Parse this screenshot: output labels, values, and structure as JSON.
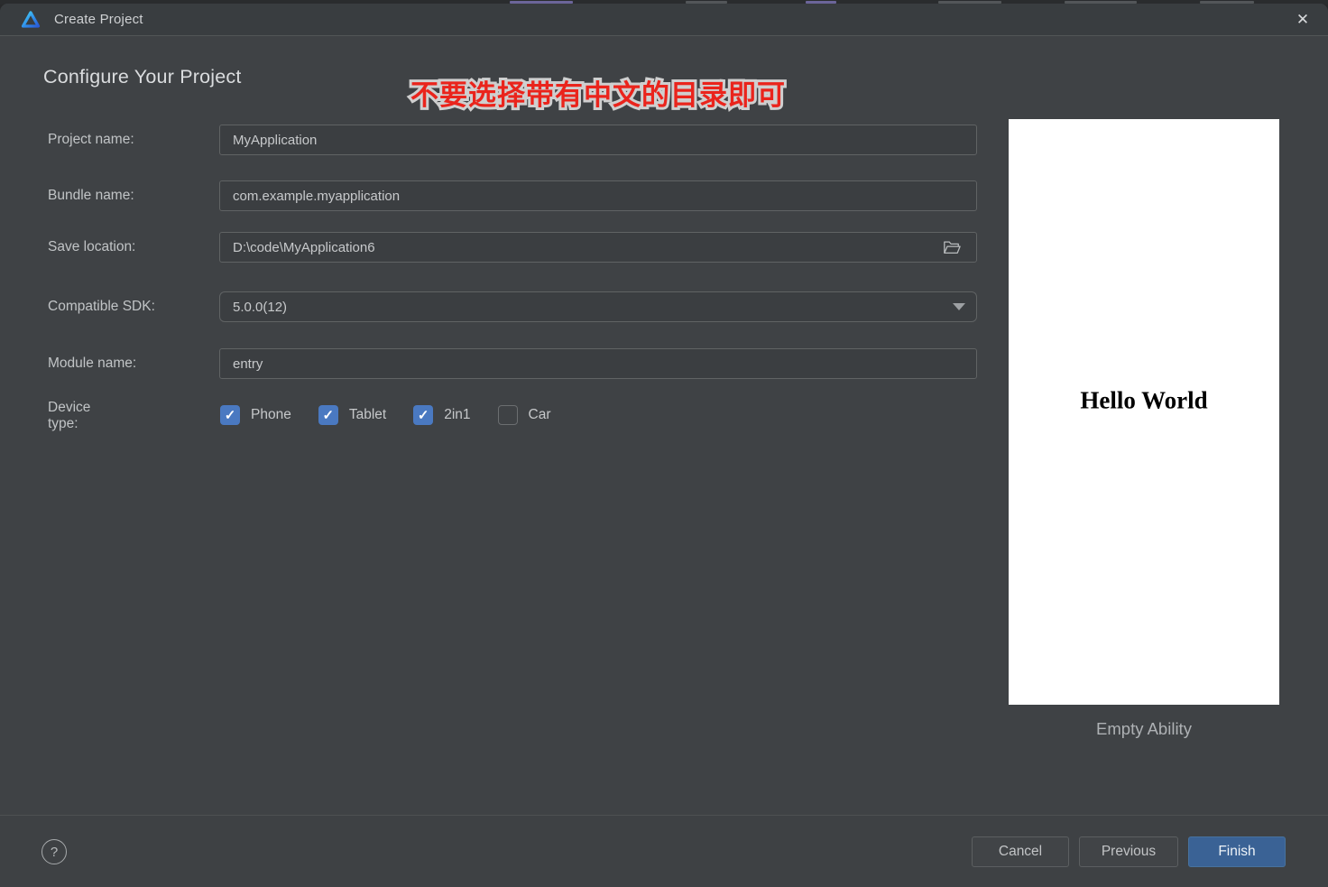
{
  "window": {
    "title": "Create Project",
    "close_icon": "✕",
    "logo_icon": "deveco-studio-logo"
  },
  "page": {
    "heading": "Configure Your Project",
    "annotation": "不要选择带有中文的目录即可",
    "annotation_color": "#ea241c"
  },
  "form": {
    "fields": [
      {
        "label": "Project name:",
        "value": "MyApplication"
      },
      {
        "label": "Bundle name:",
        "value": "com.example.myapplication"
      },
      {
        "label": "Save location:",
        "value": "D:\\code\\MyApplication6",
        "trailing_icon": "folder-open-icon"
      },
      {
        "label": "Compatible SDK:",
        "value": "5.0.0(12)",
        "trailing_icon": "dropdown-arrow-icon"
      },
      {
        "label": "Module name:",
        "value": "entry"
      }
    ],
    "device_type": {
      "label": "Device type:",
      "options": [
        {
          "label": "Phone",
          "state": "checked"
        },
        {
          "label": "Tablet",
          "state": "checked"
        },
        {
          "label": "2in1",
          "state": "checked"
        },
        {
          "label": "Car",
          "state": "unchecked"
        }
      ]
    }
  },
  "preview": {
    "screen_text": "Hello World",
    "caption": "Empty Ability",
    "screen_bg": "#ffffff"
  },
  "footer": {
    "help_icon": "?",
    "buttons": {
      "cancel": "Cancel",
      "previous": "Previous",
      "finish": "Finish"
    }
  },
  "icons": {
    "check": "✓"
  },
  "colors": {
    "dialog_bg": "#3f4245",
    "titlebar_bg": "#393d40",
    "input_bg": "#3b3e41",
    "input_border": "#606364",
    "checkbox_blue": "#4a79c1",
    "finish_blue": "#3a6295"
  }
}
